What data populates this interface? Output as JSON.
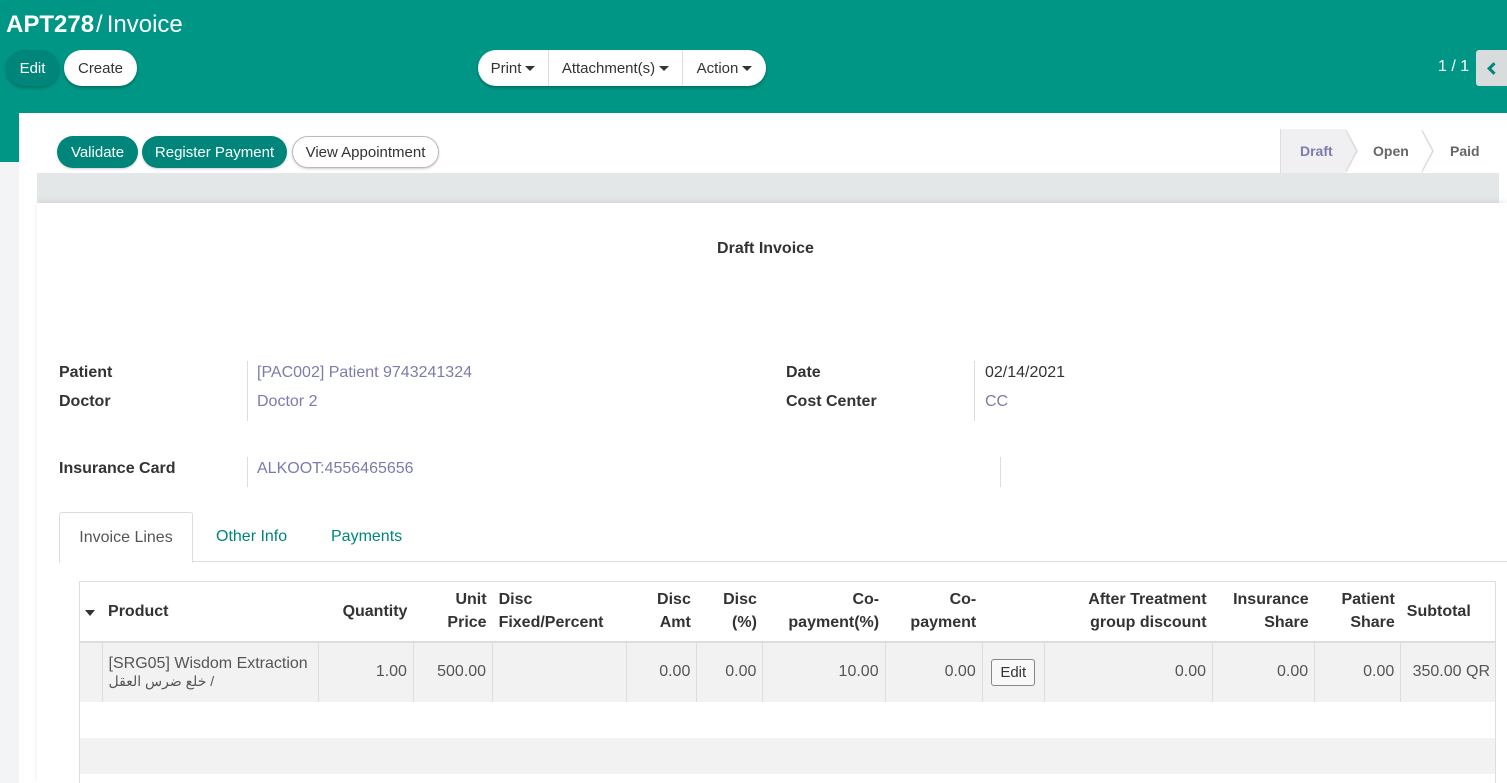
{
  "breadcrumb": {
    "record": "APT278",
    "separator": "/",
    "current": "Invoice"
  },
  "control": {
    "edit_label": "Edit",
    "create_label": "Create",
    "print_label": "Print",
    "attachments_label": "Attachment(s)",
    "action_label": "Action",
    "pager": "1 / 1"
  },
  "header": {
    "validate_label": "Validate",
    "register_payment_label": "Register Payment",
    "view_appointment_label": "View Appointment",
    "stages": [
      "Draft",
      "Open",
      "Paid"
    ],
    "active_stage": "Draft"
  },
  "sheet": {
    "title": "Draft Invoice",
    "fields": {
      "patient_label": "Patient",
      "patient_value": "[PAC002] Patient 9743241324",
      "doctor_label": "Doctor",
      "doctor_value": "Doctor 2",
      "date_label": "Date",
      "date_value": "02/14/2021",
      "cost_center_label": "Cost Center",
      "cost_center_value": "CC",
      "insurance_label": "Insurance Card",
      "insurance_value": "ALKOOT:4556465656"
    },
    "tabs": [
      "Invoice Lines",
      "Other Info",
      "Payments"
    ]
  },
  "lines": {
    "headers": {
      "product": "Product",
      "quantity": "Quantity",
      "unit_price": "Unit Price",
      "disc_type": "Disc Fixed/Percent",
      "disc_amt": "Disc Amt",
      "disc_pct": "Disc (%)",
      "copay_pct": "Co-payment(%)",
      "copay": "Co-payment",
      "after_treatment": "After Treatment group discount",
      "insurance_share": "Insurance Share",
      "patient_share": "Patient Share",
      "subtotal": "Subtotal"
    },
    "rows": [
      {
        "product": "[SRG05] Wisdom Extraction",
        "product_sub": "/ خلع ضرس العقل",
        "quantity": "1.00",
        "unit_price": "500.00",
        "disc_type": "",
        "disc_amt": "0.00",
        "disc_pct": "0.00",
        "copay_pct": "10.00",
        "copay": "0.00",
        "edit_label": "Edit",
        "after_treatment": "0.00",
        "insurance_share": "0.00",
        "patient_share": "0.00",
        "subtotal": "350.00 QR"
      }
    ]
  },
  "colors": {
    "primary": "#009685",
    "primary_dark": "#00857a",
    "link": "#7c7bad"
  }
}
